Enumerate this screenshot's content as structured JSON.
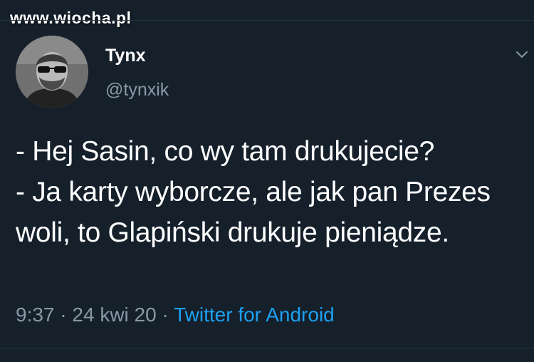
{
  "watermark": "www.wiocha.pl",
  "author": {
    "name": "Tynx",
    "handle": "@tynxik"
  },
  "tweet": {
    "text": "- Hej Sasin, co wy tam drukujecie?\n- Ja karty wyborcze, ale jak pan Prezes woli, to Glapiński drukuje pieniądze.",
    "time": "9:37",
    "separator": " · ",
    "date": "24 kwi 20",
    "source": "Twitter for Android"
  },
  "colors": {
    "background": "#15202b",
    "text": "#ffffff",
    "secondary": "#8899a6",
    "link": "#1da1f2"
  },
  "icons": {
    "menu": "chevron-down-icon"
  }
}
